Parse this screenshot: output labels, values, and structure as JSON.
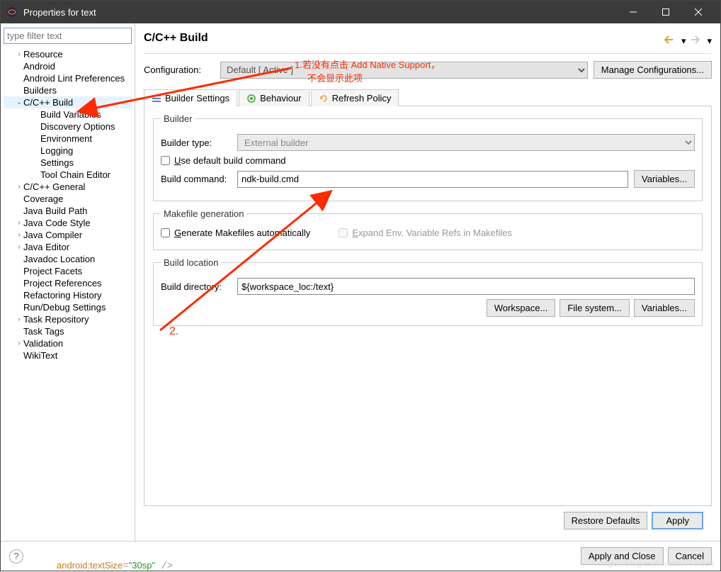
{
  "window": {
    "title": "Properties for text"
  },
  "filter": {
    "placeholder": "type filter text"
  },
  "tree": {
    "items": [
      {
        "label": "Resource",
        "caret": ">"
      },
      {
        "label": "Android"
      },
      {
        "label": "Android Lint Preferences"
      },
      {
        "label": "Builders"
      },
      {
        "label": "C/C++ Build",
        "caret": "v",
        "sel": true
      },
      {
        "label": "Build Variables",
        "child": true
      },
      {
        "label": "Discovery Options",
        "child": true
      },
      {
        "label": "Environment",
        "child": true
      },
      {
        "label": "Logging",
        "child": true
      },
      {
        "label": "Settings",
        "child": true
      },
      {
        "label": "Tool Chain Editor",
        "child": true
      },
      {
        "label": "C/C++ General",
        "caret": ">"
      },
      {
        "label": "Coverage"
      },
      {
        "label": "Java Build Path"
      },
      {
        "label": "Java Code Style",
        "caret": ">"
      },
      {
        "label": "Java Compiler",
        "caret": ">"
      },
      {
        "label": "Java Editor",
        "caret": ">"
      },
      {
        "label": "Javadoc Location"
      },
      {
        "label": "Project Facets"
      },
      {
        "label": "Project References"
      },
      {
        "label": "Refactoring History"
      },
      {
        "label": "Run/Debug Settings"
      },
      {
        "label": "Task Repository",
        "caret": ">"
      },
      {
        "label": "Task Tags"
      },
      {
        "label": "Validation",
        "caret": ">"
      },
      {
        "label": "WikiText"
      }
    ]
  },
  "page": {
    "title": "C/C++ Build",
    "config_label": "Configuration:",
    "config_value": "Default [ Active ]",
    "manage": "Manage Configurations...",
    "tabs": [
      "Builder Settings",
      "Behaviour",
      "Refresh Policy"
    ],
    "builder": {
      "legend": "Builder",
      "type_label": "Builder type:",
      "type_value": "External builder",
      "use_default": "se default build command",
      "use_default_u": "U",
      "cmd_label": "Build command:",
      "cmd_value": "ndk-build.cmd",
      "variables": "Variables..."
    },
    "makefile": {
      "legend": "Makefile generation",
      "gen_u": "G",
      "gen": "enerate Makefiles automatically",
      "expand_u": "E",
      "expand": "xpand Env. Variable Refs in Makefiles"
    },
    "location": {
      "legend": "Build location",
      "dir_label": "Build directory:",
      "dir_u": "y",
      "dir_value": "${workspace_loc:/text}",
      "workspace": "Workspace...",
      "filesystem": "File system...",
      "variables": "Variables..."
    },
    "restore": "Restore Defaults",
    "restore_u": "D",
    "apply": "Apply"
  },
  "bottom": {
    "apply_close": "Apply and Close",
    "cancel": "Cancel"
  },
  "annotations": {
    "a1_line1": "1.若没有点击 Add Native Support，",
    "a1_line2": "不会显示此项",
    "a2": "2."
  },
  "watermark": "https://blog.csdn.net/MrYolden"
}
